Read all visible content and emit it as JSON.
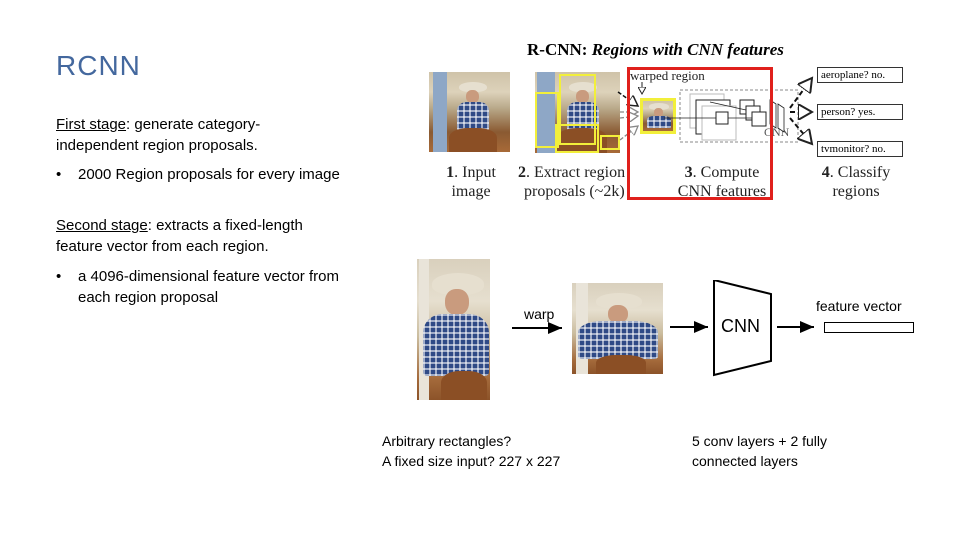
{
  "slide": {
    "title": "RCNN",
    "first_stage": {
      "label": "First stage",
      "text": ": generate category-independent region proposals.",
      "bullet": "2000 Region proposals for every image"
    },
    "second_stage": {
      "label": "Second stage",
      "text": ": extracts a fixed-length feature vector from each region.",
      "bullet": "a 4096-dimensional feature vector from each region proposal"
    },
    "bullet_char": "•"
  },
  "top_figure": {
    "title_bold": "R-CNN: ",
    "title_italic": "Regions with CNN features",
    "warped_label": "warped region",
    "cnn_label": "CNN",
    "classes": [
      "aeroplane? no.",
      "person? yes.",
      "tvmonitor? no."
    ],
    "steps": [
      {
        "num": "1",
        "line1": ". Input",
        "line2": "image"
      },
      {
        "num": "2",
        "line1": ". Extract region",
        "line2": "proposals (~2k)"
      },
      {
        "num": "3",
        "line1": ". Compute",
        "line2": "CNN features"
      },
      {
        "num": "4",
        "line1": ". Classify",
        "line2": "regions"
      }
    ],
    "highlight_color": "#e0201c",
    "proposal_color": "#f2ef3a"
  },
  "pipeline": {
    "warp_label": "warp",
    "cnn_label": "CNN",
    "feature_vector_label": "feature vector",
    "note_left": [
      "Arbitrary rectangles?",
      "A fixed size input? 227 x 227"
    ],
    "note_right": [
      "5 conv layers + 2 fully",
      "connected layers"
    ]
  },
  "colors": {
    "title": "#44689e"
  }
}
